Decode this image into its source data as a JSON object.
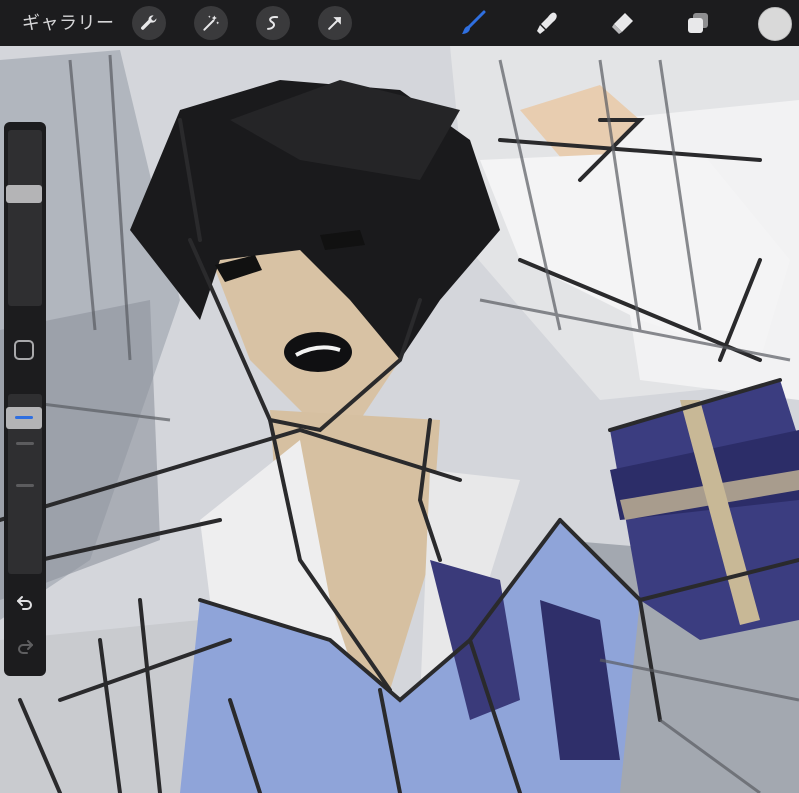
{
  "toolbar": {
    "gallery_label": "ギャラリー",
    "left_tools": [
      "wrench-icon",
      "magic-wand-icon",
      "selection-icon",
      "transform-arrow-icon"
    ],
    "right_tools": [
      "brush-icon",
      "smudge-icon",
      "eraser-icon",
      "layers-icon"
    ],
    "active_tool": "brush-icon",
    "active_color": "#2f6fe0",
    "current_color": "#d9d9d9",
    "icon_color": "#e8e8ea"
  },
  "sidebar": {
    "brush_size_level": 0.35,
    "opacity_level": 0.08,
    "accent": "#2f6fe0",
    "controls": [
      "brush-size-slider",
      "modify-button",
      "opacity-slider",
      "undo-button",
      "redo-button"
    ]
  }
}
